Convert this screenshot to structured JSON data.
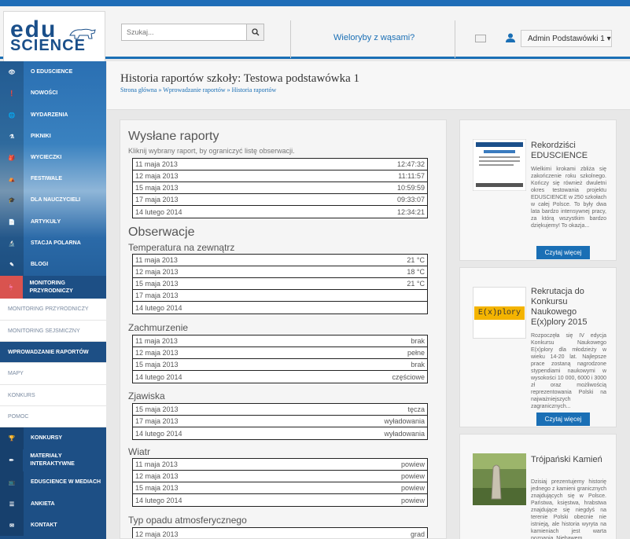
{
  "header": {
    "logo_top": "edu",
    "logo_bottom": "SCIENCE",
    "search_placeholder": "Szukaj...",
    "whales_link": "Wieloryby z wąsami?",
    "user_name": "Admin Podstawówki 1 ▾"
  },
  "sidebar": {
    "items": [
      {
        "label": "O EDUSCIENCE",
        "icon": "eye-icon"
      },
      {
        "label": "NOWOŚCI",
        "icon": "alert-icon"
      },
      {
        "label": "WYDARZENIA",
        "icon": "globe-icon"
      },
      {
        "label": "PIKNIKI",
        "icon": "flask-icon"
      },
      {
        "label": "WYCIECZKI",
        "icon": "backpack-icon"
      },
      {
        "label": "FESTIWALE",
        "icon": "tent-icon"
      },
      {
        "label": "DLA NAUCZYCIELI",
        "icon": "graduation-icon"
      },
      {
        "label": "ARTYKUŁY",
        "icon": "document-icon"
      },
      {
        "label": "STACJA POLARNA",
        "icon": "microscope-icon"
      },
      {
        "label": "BLOGI",
        "icon": "blog-icon"
      },
      {
        "label": "MONITORING PRZYRODNICZY",
        "icon": "bird-icon"
      }
    ],
    "subitems": [
      {
        "label": "MONITORING PRZYRODNICZY"
      },
      {
        "label": "MONITORING SEJSMICZNY"
      },
      {
        "label": "WPROWADZANIE RAPORTÓW"
      },
      {
        "label": "MAPY"
      },
      {
        "label": "KONKURS"
      },
      {
        "label": "POMOC"
      }
    ],
    "bottom_items": [
      {
        "label": "KONKURSY",
        "icon": "trophy-icon"
      },
      {
        "label": "MATERIAŁY INTERAKTYWNE",
        "icon": "pencil-icon"
      },
      {
        "label": "EDUSCIENCE W MEDIACH",
        "icon": "tv-icon"
      },
      {
        "label": "ANKIETA",
        "icon": "list-icon"
      },
      {
        "label": "KONTAKT",
        "icon": "envelope-icon"
      }
    ]
  },
  "page": {
    "title": "Historia raportów szkoły: Testowa podstawówka 1",
    "breadcrumb": "Strona główna » Wprowadzanie raportów » Historia raportów"
  },
  "reports": {
    "heading": "Wysłane raporty",
    "hint": "Kliknij wybrany raport, by ograniczyć listę obserwacji.",
    "rows": [
      {
        "date": "11 maja 2013",
        "time": "12:47:32"
      },
      {
        "date": "12 maja 2013",
        "time": "11:11:57"
      },
      {
        "date": "15 maja 2013",
        "time": "10:59:59"
      },
      {
        "date": "17 maja 2013",
        "time": "09:33:07"
      },
      {
        "date": "14 lutego 2014",
        "time": "12:34:21"
      }
    ]
  },
  "observations": {
    "heading": "Obserwacje",
    "groups": [
      {
        "title": "Temperatura na zewnątrz",
        "rows": [
          {
            "date": "11 maja 2013",
            "value": "21 °C"
          },
          {
            "date": "12 maja 2013",
            "value": "18 °C"
          },
          {
            "date": "15 maja 2013",
            "value": "21 °C"
          },
          {
            "date": "17 maja 2013",
            "value": ""
          },
          {
            "date": "14 lutego 2014",
            "value": ""
          }
        ]
      },
      {
        "title": "Zachmurzenie",
        "rows": [
          {
            "date": "11 maja 2013",
            "value": "brak"
          },
          {
            "date": "12 maja 2013",
            "value": "pełne"
          },
          {
            "date": "15 maja 2013",
            "value": "brak"
          },
          {
            "date": "14 lutego 2014",
            "value": "częściowe"
          }
        ]
      },
      {
        "title": "Zjawiska",
        "rows": [
          {
            "date": "15 maja 2013",
            "value": "tęcza"
          },
          {
            "date": "17 maja 2013",
            "value": "wyładowania"
          },
          {
            "date": "14 lutego 2014",
            "value": "wyładowania"
          }
        ]
      },
      {
        "title": "Wiatr",
        "rows": [
          {
            "date": "11 maja 2013",
            "value": "powiew"
          },
          {
            "date": "12 maja 2013",
            "value": "powiew"
          },
          {
            "date": "15 maja 2013",
            "value": "powiew"
          },
          {
            "date": "14 lutego 2014",
            "value": "powiew"
          }
        ]
      },
      {
        "title": "Typ opadu atmosferycznego",
        "rows": [
          {
            "date": "12 maja 2013",
            "value": "grad"
          }
        ]
      }
    ]
  },
  "cards": [
    {
      "title": "Rekordziści EDUSCIENCE",
      "text": "Wielkimi krokami zbliża się zakończenie roku szkolnego. Kończy się również dwuletni okres testowania projektu EDUSCIENCE w 250 szkołach w całej Polsce. To były dwa lata bardzo intensywnej pracy, za którą wszystkim bardzo dziękujemy! To okazja...",
      "button": "Czytaj więcej"
    },
    {
      "title": "Rekrutacja do Konkursu Naukowego E(x)plory 2015",
      "text": "Rozpoczęła się IV edycja Konkursu Naukowego E(x)plory dla młodzieży w wieku 14-20 lat. Najlepsze prace zostaną nagrodzone stypendiami naukowymi w wysokości 10 000, 6000 i 3000 zł oraz możliwością reprezentowania Polski na najważniejszych zagranicznych...",
      "button": "Czytaj więcej",
      "logo_text": "E(x)plory"
    },
    {
      "title": "Trójpański Kamień",
      "text": "Dzisiaj prezentujemy historię jednego z kamieni granicznych znajdujących się w Polsce. Państwa, księstwa, hrabstwa znajdujące się niegdyś na terenie Polski obecnie nie istnieją, ale historia wyryta na kamieniach jest warta poznania. Niebawem..."
    }
  ],
  "colors": {
    "accent": "#1a6fb5",
    "sidebar": "#1d4f85"
  }
}
